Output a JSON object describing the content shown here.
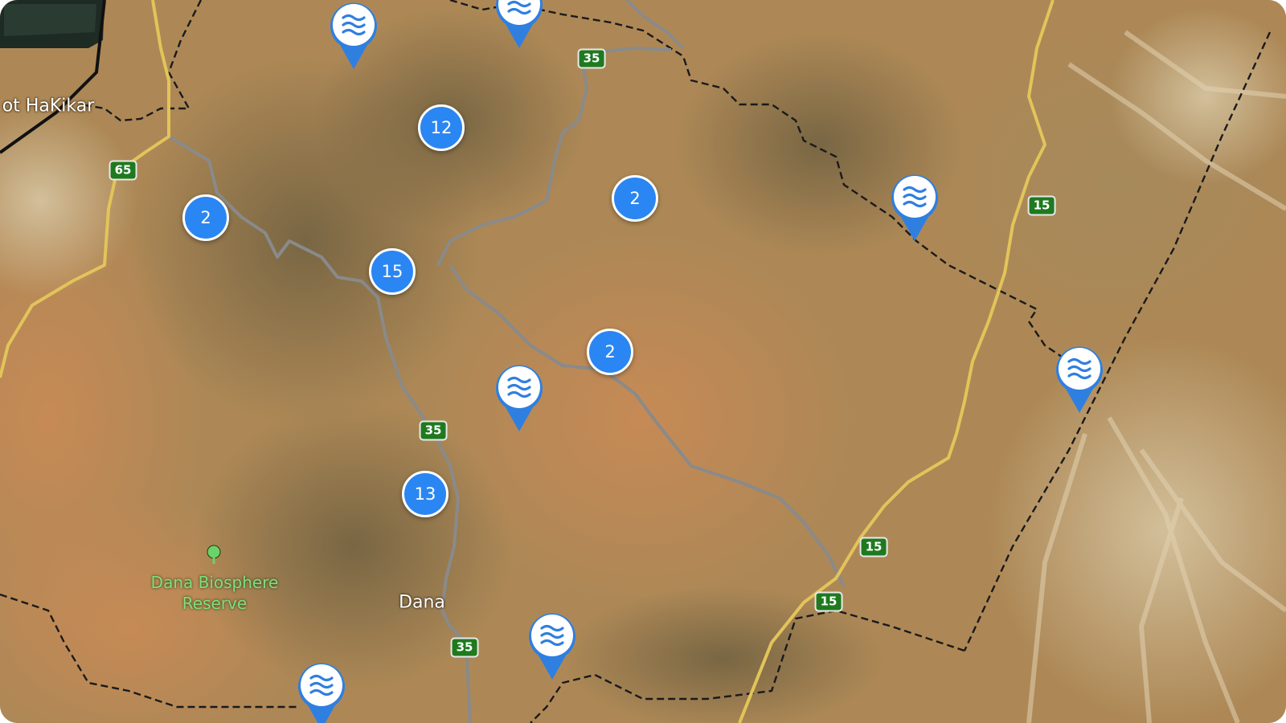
{
  "map": {
    "type": "satellite",
    "place_labels": {
      "top_left": "ot HaKikar",
      "town": "Dana"
    },
    "park": {
      "name_line1": "Dana Biosphere",
      "name_line2": "Reserve",
      "icon": "tree-icon"
    },
    "route_shields": {
      "r65": "65",
      "r35_a": "35",
      "r35_b": "35",
      "r35_c": "35",
      "r15_a": "15",
      "r15_b": "15",
      "r15_c": "15"
    },
    "clusters": {
      "c1": "12",
      "c2": "2",
      "c3": "2",
      "c4": "15",
      "c5": "2",
      "c6": "13"
    },
    "marker_icon": "water-waves-icon",
    "colors": {
      "cluster": "#2a86f2",
      "pin": "#2f7fe0",
      "shield": "#1f7a1f",
      "highway": "#e2c45a",
      "road": "#8a8a8a",
      "border": "#1a1a1a"
    }
  }
}
